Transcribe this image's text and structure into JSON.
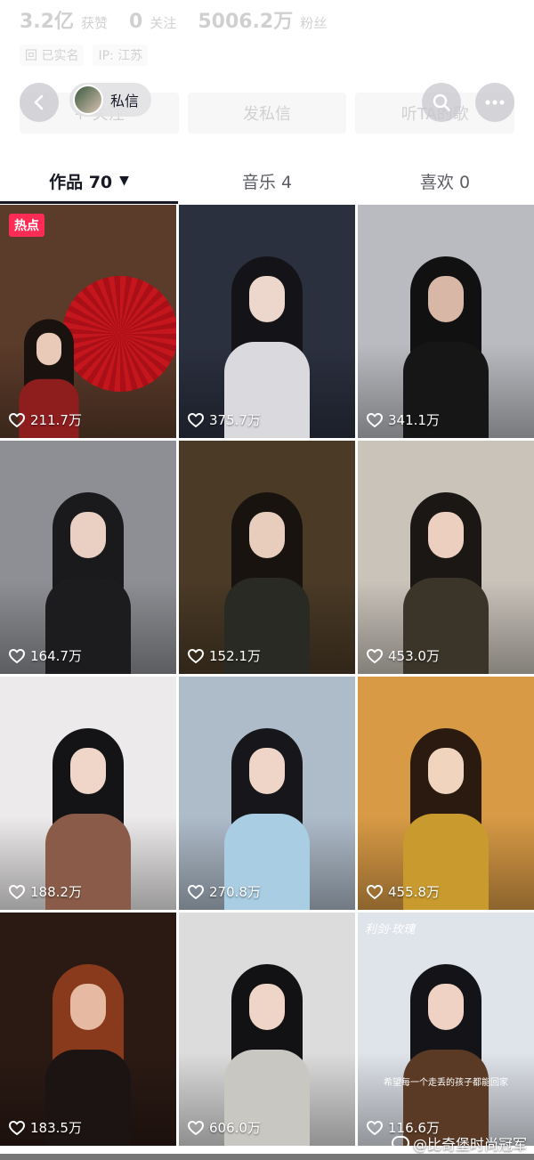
{
  "profile": {
    "stats": [
      {
        "num": "3.2亿",
        "label": "获赞"
      },
      {
        "num": "0",
        "label": "关注"
      },
      {
        "num": "5006.2万",
        "label": "粉丝"
      }
    ],
    "tags": [
      "回 已实名",
      "IP: 江苏"
    ],
    "actions": [
      "+ 关注",
      "发私信",
      "听TA的歌"
    ]
  },
  "topbar": {
    "dm_label": "私信"
  },
  "tabs": [
    {
      "label": "作品 70",
      "caret": "▼",
      "active": true
    },
    {
      "label": "音乐 4",
      "active": false
    },
    {
      "label": "喜欢 0",
      "active": false
    }
  ],
  "grid": {
    "items": [
      {
        "likes": "211.7万",
        "badge": "热点",
        "bg": "#5b3b2a",
        "hair": "#1a120e",
        "skin": "#e9c9b7",
        "outfit": "#8e1d1e"
      },
      {
        "likes": "375.7万",
        "bg": "#2b303f",
        "hair": "#141418",
        "skin": "#edd6cb",
        "outfit": "#d9d9de"
      },
      {
        "likes": "341.1万",
        "bg": "#b9bbc0",
        "hair": "#111111",
        "skin": "#d9b7a6",
        "outfit": "#161616"
      },
      {
        "likes": "164.7万",
        "bg": "#8e8f94",
        "hair": "#1a1a1d",
        "skin": "#ead0c2",
        "outfit": "#1c1c1e"
      },
      {
        "likes": "152.1万",
        "bg": "#4a3a26",
        "hair": "#18130f",
        "skin": "#e8cdbd",
        "outfit": "#2a2a24"
      },
      {
        "likes": "453.0万",
        "bg": "#c9c3ba",
        "hair": "#1b1715",
        "skin": "#eccfbf",
        "outfit": "#3a3528"
      },
      {
        "likes": "188.2万",
        "bg": "#eceaea",
        "hair": "#141416",
        "skin": "#f0d6c9",
        "outfit": "#8a5b48"
      },
      {
        "likes": "270.8万",
        "bg": "#aebbc9",
        "hair": "#17171b",
        "skin": "#efd5c8",
        "outfit": "#a9cde3"
      },
      {
        "likes": "455.8万",
        "bg": "#d89a45",
        "hair": "#2a1a10",
        "skin": "#f0d4bd",
        "outfit": "#c99a2e"
      },
      {
        "likes": "183.5万",
        "bg": "#2b1a14",
        "hair": "#8a3a1c",
        "skin": "#e5b9a2",
        "outfit": "#1b1412"
      },
      {
        "likes": "606.0万",
        "bg": "#dcdcdc",
        "hair": "#121214",
        "skin": "#efd5c8",
        "outfit": "#c9c7c2"
      },
      {
        "likes": "116.6万",
        "bg": "#dfe3ea",
        "hair": "#141418",
        "skin": "#efd2c3",
        "outfit": "#5a3a25",
        "caption": "希望每一个走丢的孩子都能回家",
        "corner": "利剑·玫瑰"
      }
    ]
  },
  "watermark": "@比奇堡时尚冠军",
  "colors": {
    "accent": "#fe2c55",
    "text": "#161823"
  }
}
